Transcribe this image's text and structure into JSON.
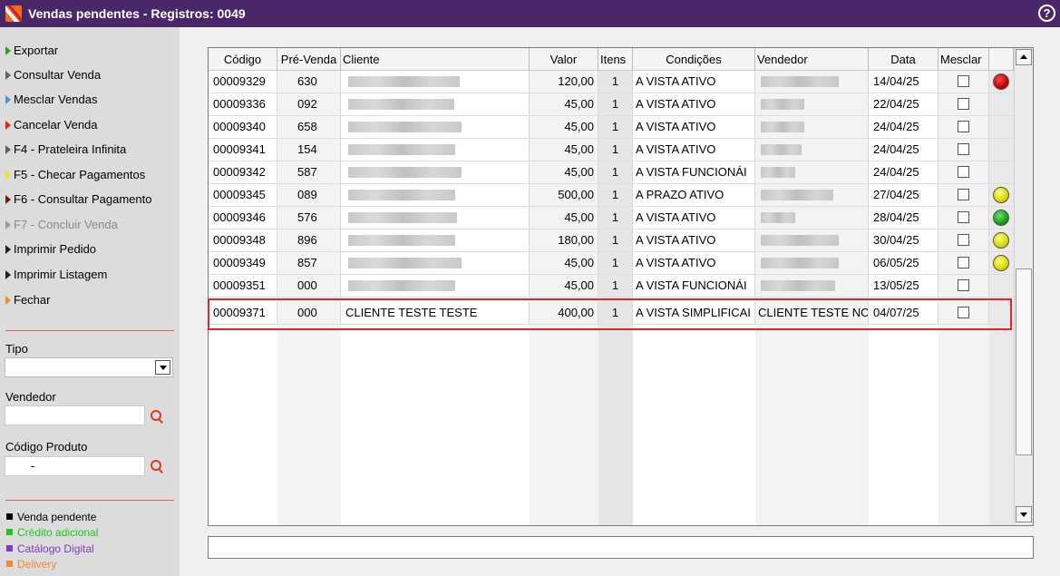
{
  "window": {
    "title": "Vendas pendentes - Registros: 0049",
    "help_icon": "?"
  },
  "sidebar": {
    "menu": [
      {
        "label": "Exportar",
        "icon": "green-arrow-icon",
        "color": "#3a9a3a",
        "disabled": false
      },
      {
        "label": "Consultar Venda",
        "icon": "gray-arrow-icon",
        "color": "#606060",
        "disabled": false
      },
      {
        "label": "Mesclar Vendas",
        "icon": "blue-arrow-icon",
        "color": "#3d9ad6",
        "disabled": false
      },
      {
        "label": "Cancelar Venda",
        "icon": "red-arrow-icon",
        "color": "#e02020",
        "disabled": false
      },
      {
        "label": "F4 - Prateleira Infinita",
        "icon": "gray-arrow-icon",
        "color": "#606060",
        "disabled": false
      },
      {
        "label": "F5 - Checar Pagamentos",
        "icon": "yellow-arrow-icon",
        "color": "#f1e21a",
        "disabled": false
      },
      {
        "label": "F6 - Consultar Pagamento",
        "icon": "darkred-arrow-icon",
        "color": "#6a1c1c",
        "disabled": false
      },
      {
        "label": "F7 - Concluir Venda",
        "icon": "gray-arrow-icon",
        "color": "#9a9a9a",
        "disabled": true
      },
      {
        "label": "Imprimir Pedido",
        "icon": "black-arrow-icon",
        "color": "#202020",
        "disabled": false
      },
      {
        "label": "Imprimir Listagem",
        "icon": "black-arrow-icon",
        "color": "#202020",
        "disabled": false
      },
      {
        "label": "Fechar",
        "icon": "orange-arrow-icon",
        "color": "#f28a2a",
        "disabled": false
      }
    ],
    "filters": {
      "tipo_label": "Tipo",
      "tipo_value": "",
      "vendedor_label": "Vendedor",
      "vendedor_value": "",
      "codigo_produto_label": "Código Produto",
      "codigo_produto_value": "-"
    },
    "legend": [
      {
        "label": "Venda pendente",
        "color": "#000000"
      },
      {
        "label": "Crédito adicional",
        "color": "#22c422"
      },
      {
        "label": "Catálogo Digital",
        "color": "#7d3cc0"
      },
      {
        "label": "Delivery",
        "color": "#f28a2a"
      }
    ]
  },
  "table": {
    "headers": [
      "Código",
      "Pré-Venda",
      "Cliente",
      "Valor",
      "Itens",
      "Condições",
      "Vendedor",
      "Data",
      "Mesclar",
      ""
    ],
    "rows": [
      {
        "codigo": "00009329",
        "prevenda": "630",
        "cliente": "",
        "valor": "120,00",
        "itens": "1",
        "condicoes": "A VISTA ATIVO",
        "vendedor": "",
        "data": "14/04/25",
        "status": "red"
      },
      {
        "codigo": "00009336",
        "prevenda": "092",
        "cliente": "",
        "valor": "45,00",
        "itens": "1",
        "condicoes": "A VISTA ATIVO",
        "vendedor": "",
        "data": "22/04/25",
        "status": ""
      },
      {
        "codigo": "00009340",
        "prevenda": "658",
        "cliente": "",
        "valor": "45,00",
        "itens": "1",
        "condicoes": "A VISTA ATIVO",
        "vendedor": "",
        "data": "24/04/25",
        "status": ""
      },
      {
        "codigo": "00009341",
        "prevenda": "154",
        "cliente": "",
        "valor": "45,00",
        "itens": "1",
        "condicoes": "A VISTA ATIVO",
        "vendedor": "",
        "data": "24/04/25",
        "status": ""
      },
      {
        "codigo": "00009342",
        "prevenda": "587",
        "cliente": "",
        "valor": "45,00",
        "itens": "1",
        "condicoes": "A VISTA FUNCIONÁI",
        "vendedor": "",
        "data": "24/04/25",
        "status": ""
      },
      {
        "codigo": "00009345",
        "prevenda": "089",
        "cliente": "",
        "valor": "500,00",
        "itens": "1",
        "condicoes": "A PRAZO ATIVO",
        "vendedor": "",
        "data": "27/04/25",
        "status": "yellow"
      },
      {
        "codigo": "00009346",
        "prevenda": "576",
        "cliente": "",
        "valor": "45,00",
        "itens": "1",
        "condicoes": "A VISTA ATIVO",
        "vendedor": "",
        "data": "28/04/25",
        "status": "green"
      },
      {
        "codigo": "00009348",
        "prevenda": "896",
        "cliente": "",
        "valor": "180,00",
        "itens": "1",
        "condicoes": "A VISTA ATIVO",
        "vendedor": "",
        "data": "30/04/25",
        "status": "yellow"
      },
      {
        "codigo": "00009349",
        "prevenda": "857",
        "cliente": "",
        "valor": "45,00",
        "itens": "1",
        "condicoes": "A VISTA ATIVO",
        "vendedor": "",
        "data": "06/05/25",
        "status": "yellow"
      },
      {
        "codigo": "00009351",
        "prevenda": "000",
        "cliente": "",
        "valor": "45,00",
        "itens": "1",
        "condicoes": "A VISTA FUNCIONÁI",
        "vendedor": "",
        "data": "13/05/25",
        "status": ""
      },
      {
        "codigo": "00009371",
        "prevenda": "000",
        "cliente": "CLIENTE TESTE TESTE",
        "valor": "400,00",
        "itens": "1",
        "condicoes": "A VISTA SIMPLIFICAI",
        "vendedor": "CLIENTE TESTE NC",
        "data": "04/07/25",
        "status": "",
        "selected": true
      }
    ]
  },
  "status_bar": {
    "text": ""
  }
}
